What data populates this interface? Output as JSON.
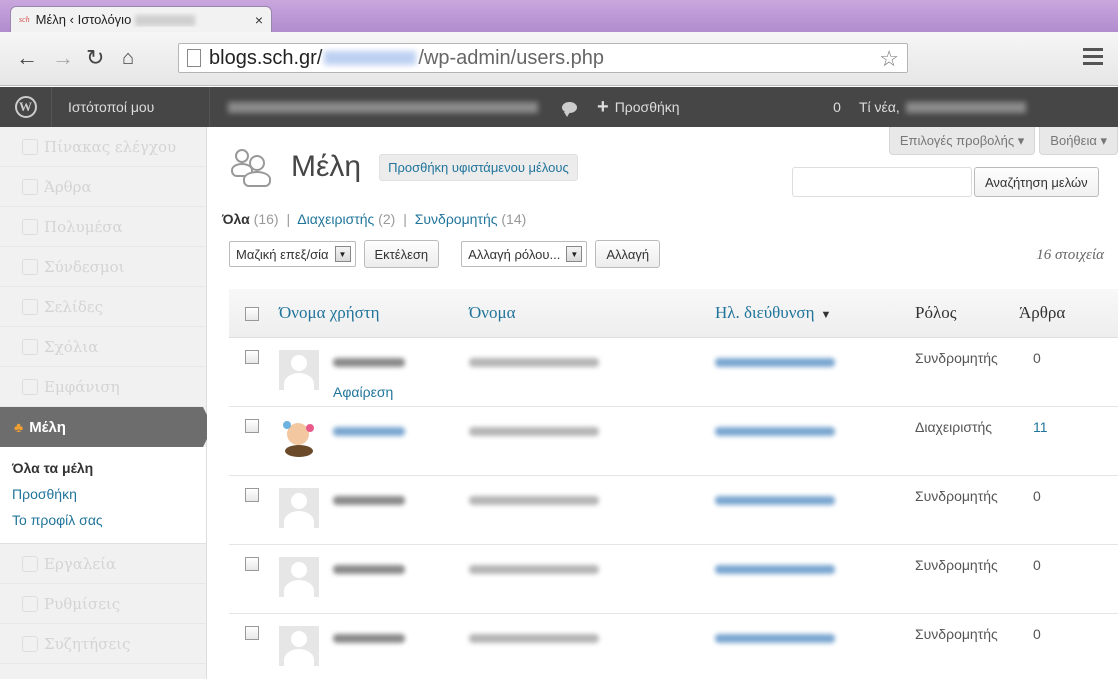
{
  "browser": {
    "tab_title": "Μέλη ‹ Ιστολόγιο",
    "favicon_text": "sch",
    "tab_close": "×",
    "url_host": "blogs.sch.gr/",
    "url_path": "/wp-admin/users.php"
  },
  "adminbar": {
    "my_sites": "Ιστότοποί μου",
    "new_label": "Προσθήκη",
    "comment_count": "0",
    "howdy": "Τί νέα,"
  },
  "sidebar": {
    "items_top": [
      {
        "label": "Πίνακας ελέγχου",
        "icon": "dashboard-icon"
      },
      {
        "label": "Άρθρα",
        "icon": "posts-icon"
      },
      {
        "label": "Πολυμέσα",
        "icon": "media-icon"
      },
      {
        "label": "Σύνδεσμοι",
        "icon": "links-icon"
      },
      {
        "label": "Σελίδες",
        "icon": "pages-icon"
      },
      {
        "label": "Σχόλια",
        "icon": "comments-icon"
      },
      {
        "label": "Εμφάνιση",
        "icon": "appearance-icon"
      }
    ],
    "active": "Μέλη",
    "submenu": [
      "Όλα τα μέλη",
      "Προσθήκη",
      "Το προφίλ σας"
    ],
    "items_bottom": [
      {
        "label": "Εργαλεία",
        "icon": "tools-icon"
      },
      {
        "label": "Ρυθμίσεις",
        "icon": "settings-icon"
      },
      {
        "label": "Συζητήσεις",
        "icon": "discussion-icon"
      }
    ]
  },
  "screen_options": "Επιλογές προβολής ▾",
  "help": "Βοήθεια ▾",
  "page_title": "Μέλη",
  "add_existing": "Προσθήκη υφιστάμενου μέλους",
  "search_button": "Αναζήτηση μελών",
  "filters": {
    "all": "Όλα",
    "all_count": "(16)",
    "admins": "Διαχειριστής",
    "admins_count": "(2)",
    "subscribers": "Συνδρομητής",
    "subscribers_count": "(14)",
    "separator": "|"
  },
  "bulk_select": "Μαζική επεξ/σία",
  "apply_button": "Εκτέλεση",
  "role_select": "Αλλαγή ρόλου...",
  "change_button": "Αλλαγή",
  "items_count": "16 στοιχεία",
  "table": {
    "headers": {
      "username": "Όνομα χρήστη",
      "name": "Όνομα",
      "email": "Ηλ. διεύθυνση",
      "role": "Ρόλος",
      "posts": "Άρθρα"
    },
    "rows": [
      {
        "role": "Συνδρομητής",
        "posts": "0",
        "action": "Αφαίρεση"
      },
      {
        "role": "Διαχειριστής",
        "posts": "11"
      },
      {
        "role": "Συνδρομητής",
        "posts": "0"
      },
      {
        "role": "Συνδρομητής",
        "posts": "0"
      },
      {
        "role": "Συνδρομητής",
        "posts": "0"
      }
    ]
  }
}
